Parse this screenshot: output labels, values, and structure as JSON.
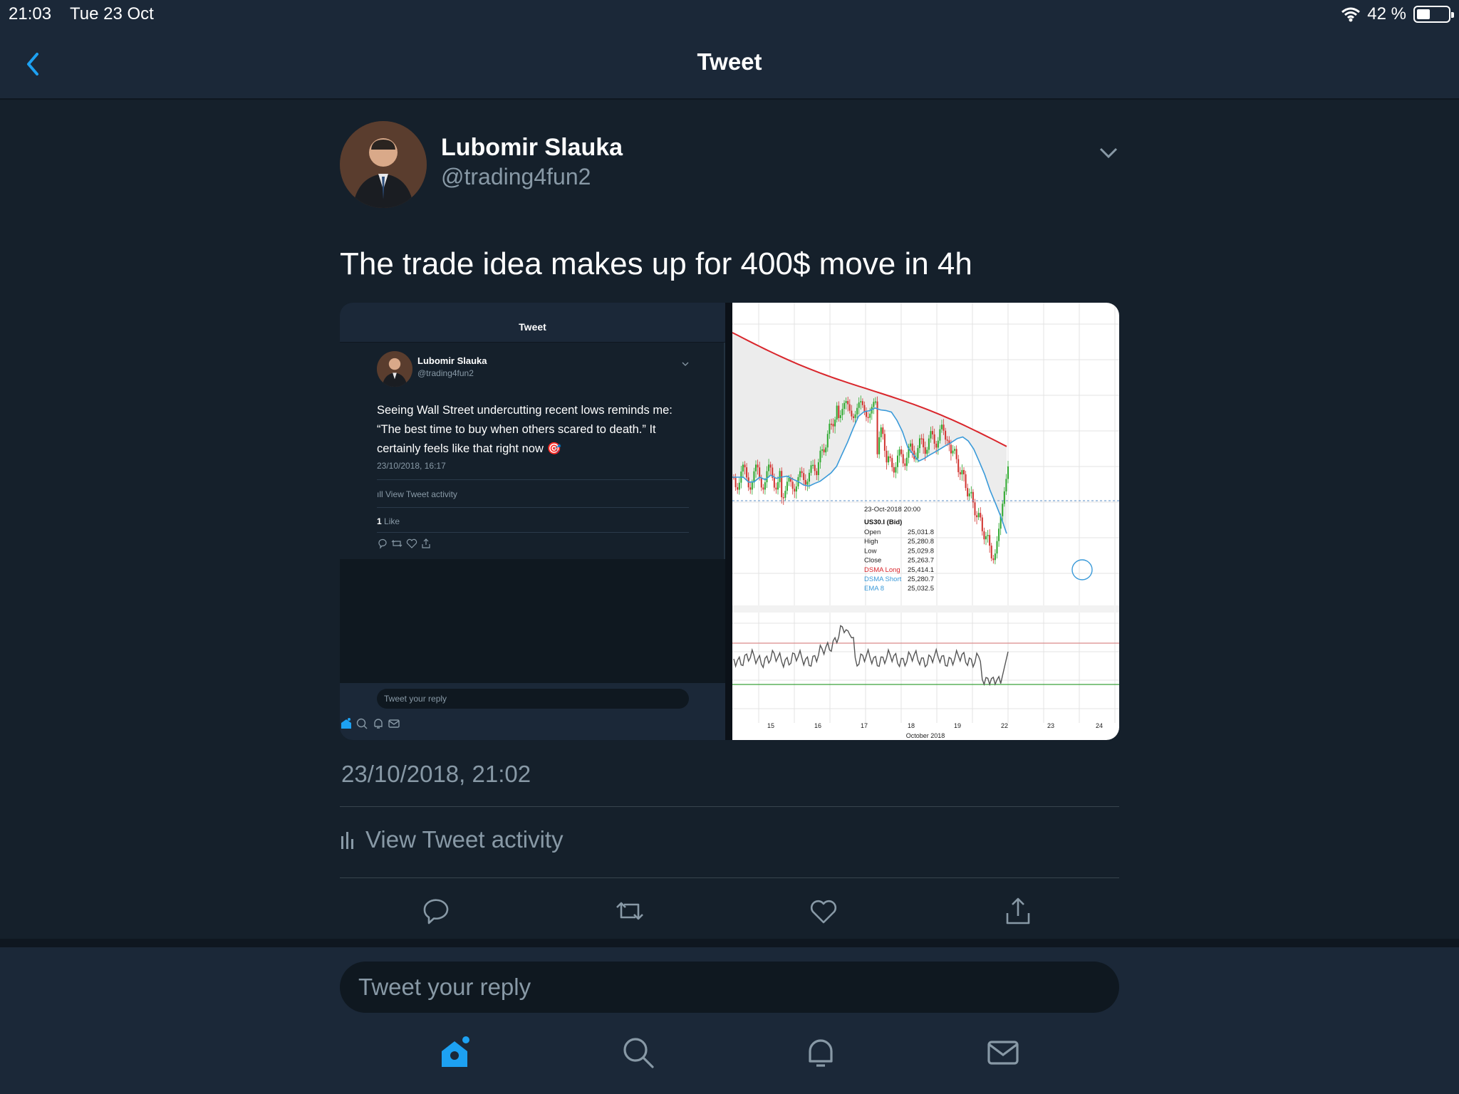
{
  "status_bar": {
    "time": "21:03",
    "date": "Tue 23 Oct",
    "battery": "42 %",
    "battery_level": 0.42
  },
  "nav": {
    "title": "Tweet",
    "back_icon": "chevron-left-icon"
  },
  "tweet": {
    "author_name": "Lubomir Slauka",
    "author_handle": "@trading4fun2",
    "text": "The trade idea makes up for 400$ move in 4h",
    "timestamp": "23/10/2018, 21:02",
    "activity_label": "View Tweet activity",
    "actions": [
      "reply-icon",
      "retweet-icon",
      "like-icon",
      "share-icon"
    ]
  },
  "media_left": {
    "nav_title": "Tweet",
    "author_name": "Lubomir Slauka",
    "author_handle": "@trading4fun2",
    "text": "Seeing Wall Street undercutting recent lows reminds me: “The best time to buy when others scared to death.” It certainly feels like that right now 🎯",
    "timestamp": "23/10/2018, 16:17",
    "activity_label": "View Tweet activity",
    "likes_count": "1",
    "likes_label": " Like",
    "reply_placeholder": "Tweet your reply"
  },
  "chart_data": {
    "type": "line",
    "instrument": "US30.I (Bid)",
    "tooltip": {
      "date": "23-Oct-2018 20:00",
      "rows": [
        {
          "label": "Open",
          "value": "25,031.8"
        },
        {
          "label": "High",
          "value": "25,280.8"
        },
        {
          "label": "Low",
          "value": "25,029.8"
        },
        {
          "label": "Close",
          "value": "25,263.7"
        },
        {
          "label": "DSMA Long",
          "value": "25,414.1"
        },
        {
          "label": "DSMA Short",
          "value": "25,280.7"
        },
        {
          "label": "EMA 8",
          "value": "25,032.5"
        }
      ]
    },
    "x_ticks": [
      "15",
      "16",
      "17",
      "18",
      "19",
      "22",
      "23",
      "24"
    ],
    "x_axis_label": "October 2018",
    "series": [
      {
        "name": "DSMA Long",
        "color": "#d9262c"
      },
      {
        "name": "DSMA Short",
        "color": "#3a9ad9"
      },
      {
        "name": "EMA 8",
        "color": "#3a9ad9"
      }
    ],
    "grid": true
  },
  "reply_placeholder": "Tweet your reply",
  "tabs": [
    "home-icon",
    "search-icon",
    "notifications-icon",
    "messages-icon"
  ],
  "colors": {
    "accent": "#1da1f2",
    "background": "#15202b",
    "muted": "#8899a6"
  }
}
